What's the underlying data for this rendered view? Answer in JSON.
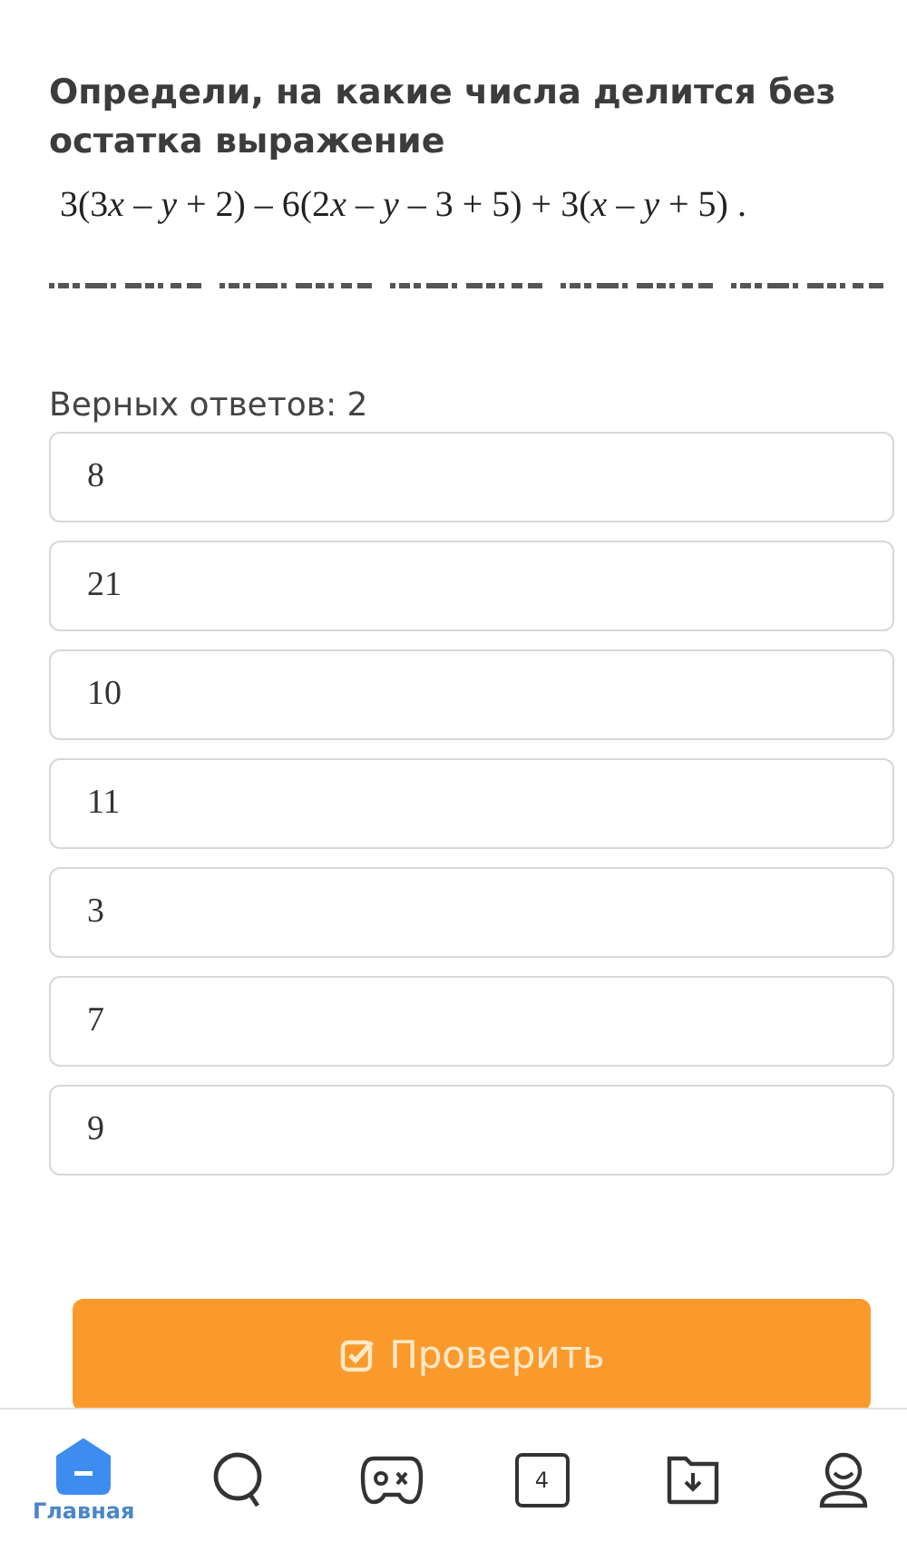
{
  "question": {
    "title": "Определи, на какие числа делится без остатка выражение",
    "expression": [
      {
        "kind": "plain",
        "text": "3(3"
      },
      {
        "kind": "var",
        "text": "x"
      },
      {
        "kind": "plain",
        "text": " – "
      },
      {
        "kind": "var",
        "text": "y"
      },
      {
        "kind": "plain",
        "text": " + 2) – 6(2"
      },
      {
        "kind": "var",
        "text": "x"
      },
      {
        "kind": "plain",
        "text": " – "
      },
      {
        "kind": "var",
        "text": "y"
      },
      {
        "kind": "plain",
        "text": " – 3 + 5) + 3("
      },
      {
        "kind": "var",
        "text": "x"
      },
      {
        "kind": "plain",
        "text": " – "
      },
      {
        "kind": "var",
        "text": "y"
      },
      {
        "kind": "plain",
        "text": " + 5) ."
      }
    ]
  },
  "answers_hint": "Верных ответов: 2",
  "options": [
    {
      "label": "8",
      "selected": false
    },
    {
      "label": "21",
      "selected": false
    },
    {
      "label": "10",
      "selected": false
    },
    {
      "label": "11",
      "selected": false
    },
    {
      "label": "3",
      "selected": false
    },
    {
      "label": "7",
      "selected": false
    },
    {
      "label": "9",
      "selected": false
    }
  ],
  "check_button": "Проверить",
  "bottom_nav": [
    {
      "kind": "home",
      "label": "Главная",
      "selected": true
    },
    {
      "kind": "search",
      "selected": false
    },
    {
      "kind": "game",
      "selected": false
    },
    {
      "kind": "counter",
      "badge": "4",
      "selected": false
    },
    {
      "kind": "folder",
      "selected": false
    },
    {
      "kind": "profile",
      "selected": false
    }
  ]
}
